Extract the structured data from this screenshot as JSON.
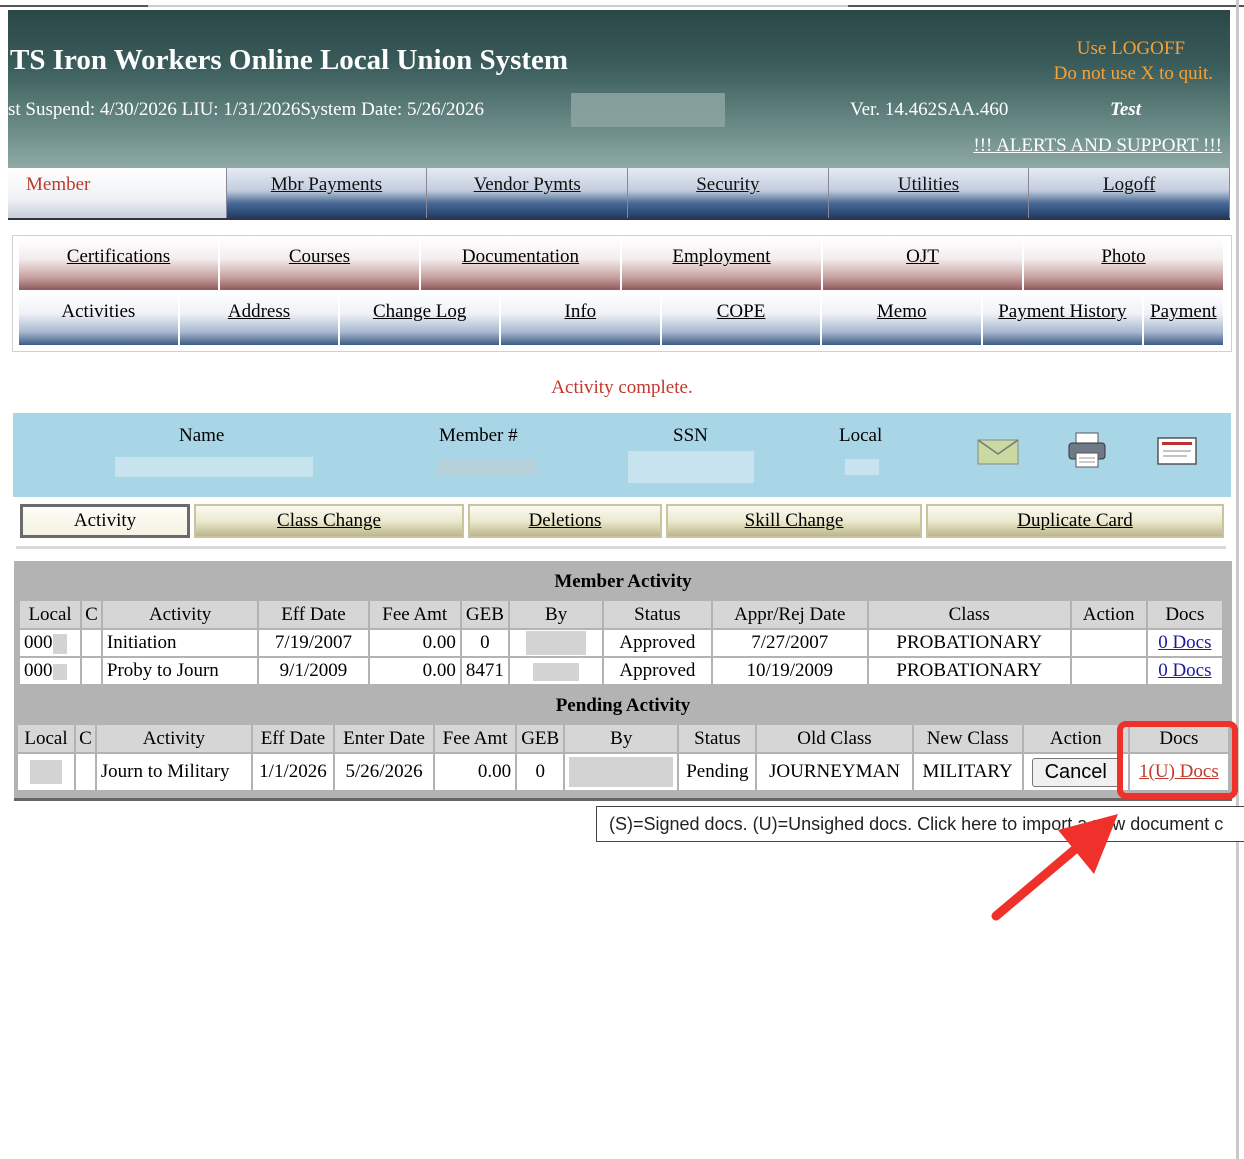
{
  "header": {
    "title": "TS Iron Workers Online Local Union System",
    "subline": "st Suspend: 4/30/2026 LIU: 1/31/2026System Date: 5/26/2026",
    "version": "Ver. 14.462SAA.460",
    "env": "Test",
    "logoff_line1": "Use LOGOFF",
    "logoff_line2": "Do not use X to quit.",
    "alerts": "!!! ALERTS AND SUPPORT !!!"
  },
  "main_nav": [
    "Member",
    "Mbr Payments",
    "Vendor Pymts",
    "Security",
    "Utilities",
    "Logoff"
  ],
  "sub_nav_row1": [
    "Certifications",
    "Courses",
    "Documentation",
    "Employment",
    "OJT",
    "Photo"
  ],
  "sub_nav_row2": [
    "Activities",
    "Address",
    "Change Log",
    "Info",
    "COPE",
    "Memo",
    "Payment History",
    "Payment"
  ],
  "message": "Activity complete.",
  "member_info": {
    "name_label": "Name",
    "member_label": "Member #",
    "ssn_label": "SSN",
    "local_label": "Local",
    "icons": [
      "envelope-icon",
      "printer-icon",
      "card-icon"
    ]
  },
  "action_tabs": [
    "Activity",
    "Class Change",
    "Deletions",
    "Skill Change",
    "Duplicate Card"
  ],
  "member_activity": {
    "title": "Member Activity",
    "columns": [
      "Local",
      "C",
      "Activity",
      "Eff Date",
      "Fee Amt",
      "GEB",
      "By",
      "Status",
      "Appr/Rej Date",
      "Class",
      "Action",
      "Docs"
    ],
    "rows": [
      {
        "local": "000",
        "activity": "Initiation",
        "eff_date": "7/19/2007",
        "fee_amt": "0.00",
        "geb": "0",
        "status": "Approved",
        "appr_date": "7/27/2007",
        "class": "PROBATIONARY",
        "docs": "0 Docs"
      },
      {
        "local": "000",
        "activity": "Proby to Journ",
        "eff_date": "9/1/2009",
        "fee_amt": "0.00",
        "geb": "8471",
        "status": "Approved",
        "appr_date": "10/19/2009",
        "class": "PROBATIONARY",
        "docs": "0 Docs"
      }
    ]
  },
  "pending_activity": {
    "title": "Pending Activity",
    "columns": [
      "Local",
      "C",
      "Activity",
      "Eff Date",
      "Enter Date",
      "Fee Amt",
      "GEB",
      "By",
      "Status",
      "Old Class",
      "New Class",
      "Action",
      "Docs"
    ],
    "rows": [
      {
        "activity": "Journ to Military",
        "eff_date": "1/1/2026",
        "enter_date": "5/26/2026",
        "fee_amt": "0.00",
        "geb": "0",
        "status": "Pending",
        "old_class": "JOURNEYMAN",
        "new_class": "MILITARY",
        "action": "Cancel",
        "docs": "1(U) Docs"
      }
    ]
  },
  "tooltip": "(S)=Signed docs. (U)=Unsighed docs.  Click here to import a new document c",
  "colors": {
    "highlight": "#f0302a",
    "message": "#c0392b",
    "header_dark": "#2a4746",
    "info_bar": "#a9d6e6"
  }
}
